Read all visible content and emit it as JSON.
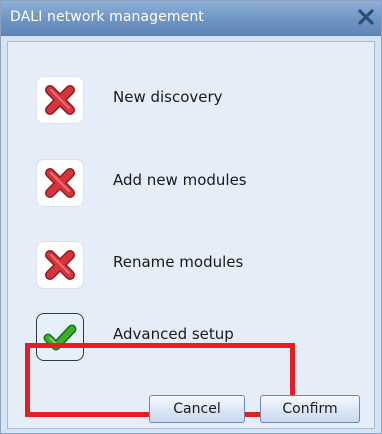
{
  "window": {
    "title": "DALI network management"
  },
  "items": [
    {
      "label": "New discovery",
      "state": "not-done",
      "icon": "red-x-icon"
    },
    {
      "label": "Add new modules",
      "state": "not-done",
      "icon": "red-x-icon"
    },
    {
      "label": "Rename modules",
      "state": "not-done",
      "icon": "red-x-icon"
    },
    {
      "label": "Advanced setup",
      "state": "done",
      "icon": "green-check-icon",
      "selected": true
    }
  ],
  "buttons": {
    "cancel": "Cancel",
    "confirm": "Confirm"
  },
  "colors": {
    "title_bar": "#6f95c4",
    "body": "#e4edf8",
    "highlight": "#e31e24",
    "x_red": "#d8323a",
    "check_green": "#3cae2e"
  }
}
